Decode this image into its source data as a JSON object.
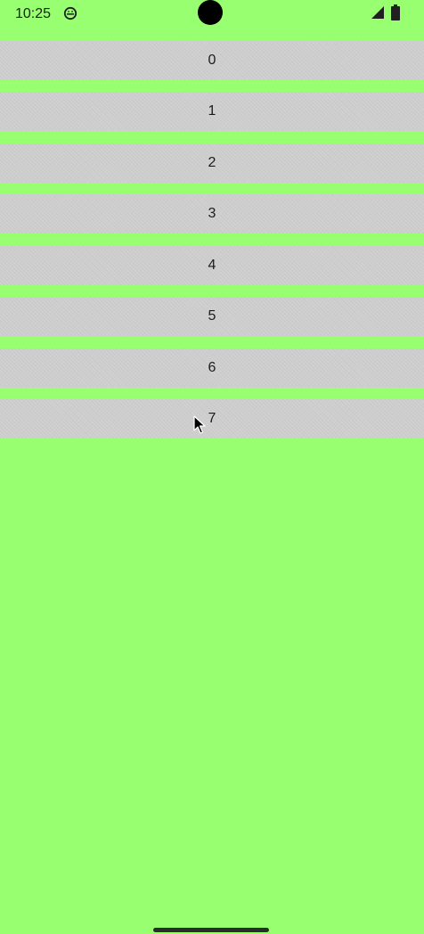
{
  "status_bar": {
    "time": "10:25",
    "app_icon": "android-robot-icon",
    "signal_icon": "signal-icon",
    "battery_icon": "battery-icon"
  },
  "list": {
    "items": [
      {
        "label": "0"
      },
      {
        "label": "1"
      },
      {
        "label": "2"
      },
      {
        "label": "3"
      },
      {
        "label": "4"
      },
      {
        "label": "5"
      },
      {
        "label": "6"
      },
      {
        "label": "7"
      }
    ]
  },
  "colors": {
    "background": "#98ff70",
    "item_background": "#cfcfcf",
    "text": "#1c1c1c"
  }
}
